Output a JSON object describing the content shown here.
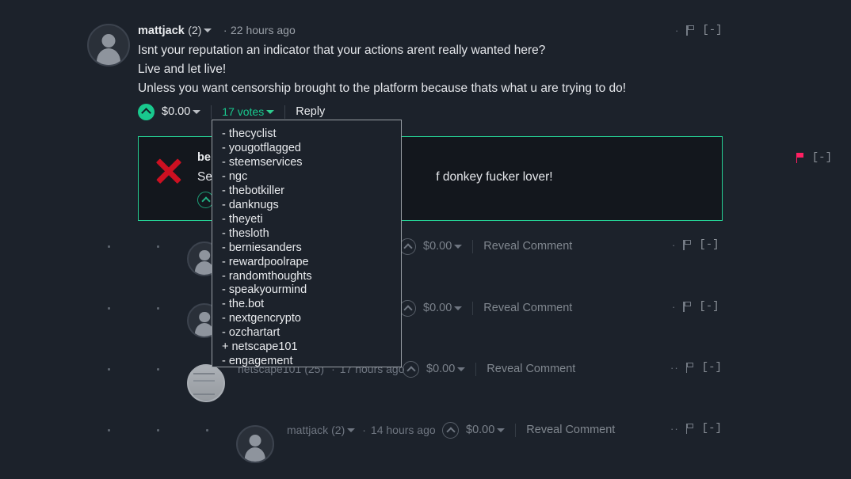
{
  "theme": {
    "background": "#1c222b",
    "accent_green": "#19c98e",
    "highlight_border": "#25d094",
    "flag_active": "#ff1f62",
    "x_mark": "#cc1021",
    "dropdown_border": "#9aa0a6"
  },
  "top_comment": {
    "author": "mattjack",
    "reputation": "(2)",
    "separator": "·",
    "timestamp": "22 hours ago",
    "body_lines": [
      "Isnt your reputation an indicator that your actions arent really wanted here?",
      "Live and let live!",
      "Unless you want censorship brought to the platform because thats what u are trying to do!"
    ],
    "payout": "$0.00",
    "votes_label": "17 votes",
    "reply_label": "Reply",
    "more_dots": "·",
    "collapse_label": "[-]"
  },
  "highlighted_comment": {
    "author_partial": "be",
    "body_partial": "Se",
    "body_visible_tail": "f donkey fucker lover!",
    "flag_state": "flagged",
    "collapse_label": "[-]"
  },
  "voter_dropdown": {
    "voters": [
      "- thecyclist",
      "- yougotflagged",
      "- steemservices",
      "- ngc",
      "- thebotkiller",
      "- danknugs",
      "- theyeti",
      "- thesloth",
      "- berniesanders",
      "- rewardpoolrape",
      "- randomthoughts",
      "- speakyourmind",
      "- the.bot",
      "- nextgencrypto",
      "- ozchartart",
      "+ netscape101",
      "- engagement"
    ]
  },
  "collapsed_replies": [
    {
      "author": "",
      "reputation": "",
      "separator": "",
      "timestamp": "",
      "payout": "$0.00",
      "reveal_label": "Reveal Comment",
      "more_dots": "·",
      "collapse_label": "[-]",
      "avatar_type": "default",
      "indent_dots": 2
    },
    {
      "author": "",
      "reputation": "",
      "separator": "",
      "timestamp": "",
      "payout": "$0.00",
      "reveal_label": "Reveal Comment",
      "more_dots": "·",
      "collapse_label": "[-]",
      "avatar_type": "default",
      "indent_dots": 2
    },
    {
      "author": "netscape101",
      "reputation": "(25)",
      "separator": "·",
      "timestamp": "17 hours ago",
      "payout": "$0.00",
      "reveal_label": "Reveal Comment",
      "more_dots": "··",
      "collapse_label": "[-]",
      "avatar_type": "photo",
      "indent_dots": 2
    },
    {
      "author": "mattjack",
      "reputation": "(2)",
      "separator": "·",
      "timestamp": "14 hours ago",
      "payout": "$0.00",
      "reveal_label": "Reveal Comment",
      "more_dots": "··",
      "collapse_label": "[-]",
      "avatar_type": "default",
      "indent_dots": 3
    }
  ]
}
